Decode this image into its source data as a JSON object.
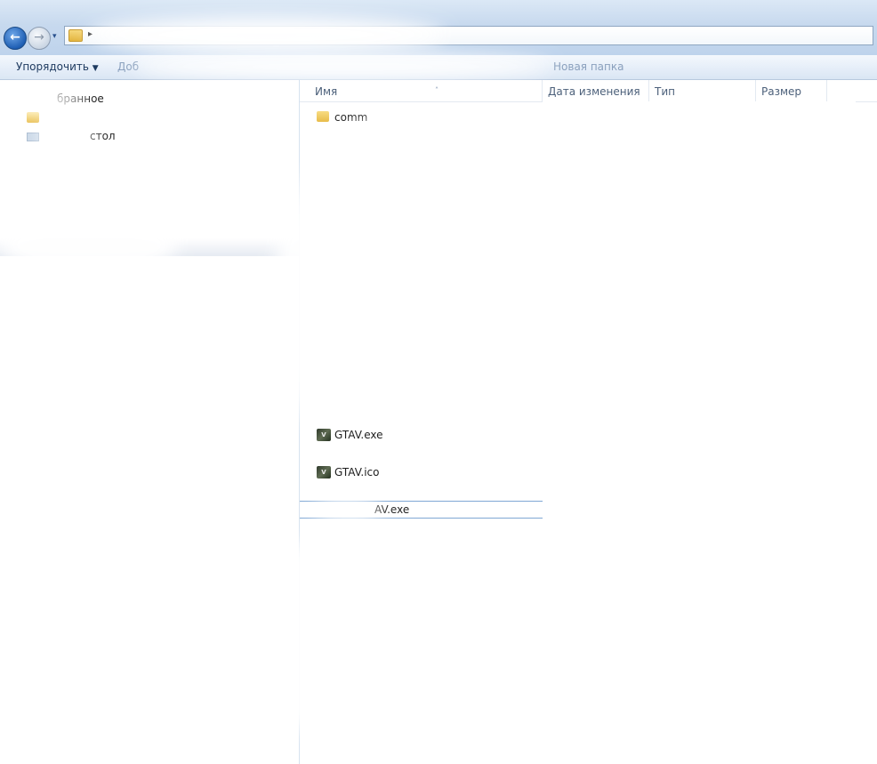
{
  "toolbar": {
    "organize_label": "Упорядочить",
    "organize_arrow": "▼",
    "add_label_partial": "Доб",
    "new_folder_label_partial": "Новая папка"
  },
  "navigation": {
    "back_glyph": "←",
    "forward_glyph": "→",
    "history_glyph": "▾",
    "chevron_glyph": "▸"
  },
  "navpane": {
    "items": [
      {
        "label": "Избранное",
        "visible_text": "бранное",
        "icon": "star-icon"
      },
      {
        "label": "",
        "icon": "folder-icon"
      },
      {
        "label": "Рабочий стол",
        "visible_text": "стол",
        "icon": "desktop-icon"
      }
    ]
  },
  "columns": {
    "name": "Имя",
    "date": "Дата изменения",
    "type": "Тип",
    "size": "Размер",
    "sort_glyph": "˄"
  },
  "files": [
    {
      "name_partial": "comm",
      "icon": "folder-icon"
    },
    {
      "name": "GTAV.exe",
      "icon": "gtav-icon"
    },
    {
      "name": "GTAV.ico",
      "icon": "gtav-icon"
    },
    {
      "name_partial": "AV.exe",
      "icon": "none"
    }
  ],
  "icon_text": {
    "gta": "V"
  }
}
